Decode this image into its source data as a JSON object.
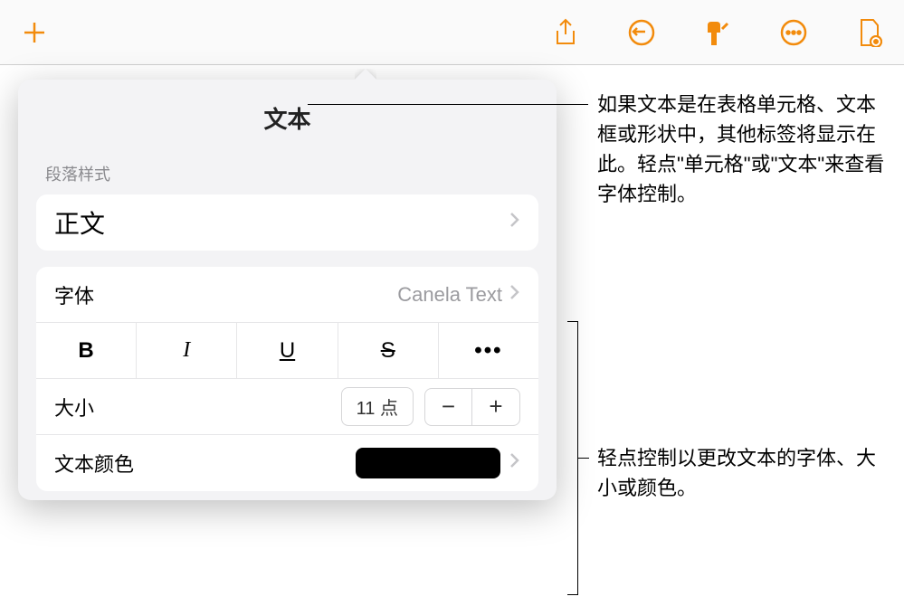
{
  "toolbar": {
    "icons": [
      "add-icon",
      "share-icon",
      "undo-icon",
      "format-icon",
      "more-icon",
      "document-icon"
    ]
  },
  "popover": {
    "title": "文本",
    "section_label": "段落样式",
    "paragraph_style": "正文",
    "font": {
      "label": "字体",
      "value": "Canela Text"
    },
    "styles": {
      "bold": "B",
      "italic": "I",
      "underline": "U",
      "strike": "S",
      "more": "•••"
    },
    "size": {
      "label": "大小",
      "value": "11 点",
      "minus": "−",
      "plus": "+"
    },
    "color": {
      "label": "文本颜色",
      "swatch": "#000000"
    }
  },
  "callouts": {
    "title": "如果文本是在表格单元格、文本框或形状中，其他标签将显示在此。轻点\"单元格\"或\"文本\"来查看字体控制。",
    "controls": "轻点控制以更改文本的字体、大小或颜色。"
  }
}
